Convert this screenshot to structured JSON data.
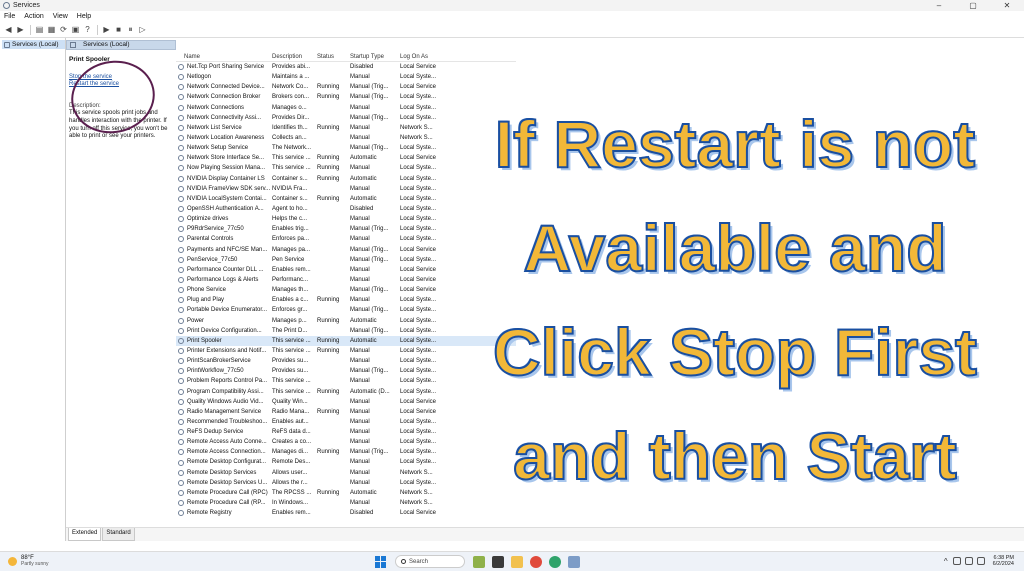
{
  "window": {
    "title": "Services",
    "controls": [
      "–",
      "▢",
      "✕"
    ]
  },
  "menu": [
    "File",
    "Action",
    "View",
    "Help"
  ],
  "tree": {
    "root": "Services (Local)"
  },
  "pane": {
    "header": "Services (Local)",
    "service_title": "Print Spooler",
    "stop_link": "Stop the service",
    "restart_link": "Restart the service",
    "description_label": "Description:",
    "description": "This service spools print jobs and handles interaction with the printer. If you turn off this service, you won't be able to print or see your printers."
  },
  "columns": [
    "Name",
    "Description",
    "Status",
    "Startup Type",
    "Log On As"
  ],
  "services": [
    [
      "Net.Tcp Port Sharing Service",
      "Provides abi...",
      "",
      "Disabled",
      "Local Service"
    ],
    [
      "Netlogon",
      "Maintains a ...",
      "",
      "Manual",
      "Local Syste..."
    ],
    [
      "Network Connected Device...",
      "Network Co...",
      "Running",
      "Manual (Trig...",
      "Local Service"
    ],
    [
      "Network Connection Broker",
      "Brokers con...",
      "Running",
      "Manual (Trig...",
      "Local Syste..."
    ],
    [
      "Network Connections",
      "Manages o...",
      "",
      "Manual",
      "Local Syste..."
    ],
    [
      "Network Connectivity Assi...",
      "Provides Dir...",
      "",
      "Manual (Trig...",
      "Local Syste..."
    ],
    [
      "Network List Service",
      "Identifies th...",
      "Running",
      "Manual",
      "Network S..."
    ],
    [
      "Network Location Awareness",
      "Collects an...",
      "",
      "Manual",
      "Network S..."
    ],
    [
      "Network Setup Service",
      "The Network...",
      "",
      "Manual (Trig...",
      "Local Syste..."
    ],
    [
      "Network Store Interface Se...",
      "This service ...",
      "Running",
      "Automatic",
      "Local Service"
    ],
    [
      "Now Playing Session Mana...",
      "This service ...",
      "Running",
      "Manual",
      "Local Syste..."
    ],
    [
      "NVIDIA Display Container LS",
      "Container s...",
      "Running",
      "Automatic",
      "Local Syste..."
    ],
    [
      "NVIDIA FrameView SDK serv...",
      "NVIDIA Fra...",
      "",
      "Manual",
      "Local Syste..."
    ],
    [
      "NVIDIA LocalSystem Contai...",
      "Container s...",
      "Running",
      "Automatic",
      "Local Syste..."
    ],
    [
      "OpenSSH Authentication A...",
      "Agent to ho...",
      "",
      "Disabled",
      "Local Syste..."
    ],
    [
      "Optimize drives",
      "Helps the c...",
      "",
      "Manual",
      "Local Syste..."
    ],
    [
      "P9RdrService_77c50",
      "Enables trig...",
      "",
      "Manual (Trig...",
      "Local Syste..."
    ],
    [
      "Parental Controls",
      "Enforces pa...",
      "",
      "Manual",
      "Local Syste..."
    ],
    [
      "Payments and NFC/SE Man...",
      "Manages pa...",
      "",
      "Manual (Trig...",
      "Local Service"
    ],
    [
      "PenService_77c50",
      "Pen Service",
      "",
      "Manual (Trig...",
      "Local Syste..."
    ],
    [
      "Performance Counter DLL ...",
      "Enables rem...",
      "",
      "Manual",
      "Local Service"
    ],
    [
      "Performance Logs & Alerts",
      "Performanc...",
      "",
      "Manual",
      "Local Service"
    ],
    [
      "Phone Service",
      "Manages th...",
      "",
      "Manual (Trig...",
      "Local Service"
    ],
    [
      "Plug and Play",
      "Enables a c...",
      "Running",
      "Manual",
      "Local Syste..."
    ],
    [
      "Portable Device Enumerator...",
      "Enforces gr...",
      "",
      "Manual (Trig...",
      "Local Syste..."
    ],
    [
      "Power",
      "Manages p...",
      "Running",
      "Automatic",
      "Local Syste..."
    ],
    [
      "Print Device Configuration...",
      "The Print D...",
      "",
      "Manual (Trig...",
      "Local Syste..."
    ],
    [
      "Print Spooler",
      "This service ...",
      "Running",
      "Automatic",
      "Local Syste..."
    ],
    [
      "Printer Extensions and Notif...",
      "This service ...",
      "Running",
      "Manual",
      "Local Syste..."
    ],
    [
      "PrintScanBrokerService",
      "Provides su...",
      "",
      "Manual",
      "Local Syste..."
    ],
    [
      "PrintWorkflow_77c50",
      "Provides su...",
      "",
      "Manual (Trig...",
      "Local Syste..."
    ],
    [
      "Problem Reports Control Pa...",
      "This service ...",
      "",
      "Manual",
      "Local Syste..."
    ],
    [
      "Program Compatibility Assi...",
      "This service ...",
      "Running",
      "Automatic (D...",
      "Local Syste..."
    ],
    [
      "Quality Windows Audio Vid...",
      "Quality Win...",
      "",
      "Manual",
      "Local Service"
    ],
    [
      "Radio Management Service",
      "Radio Mana...",
      "Running",
      "Manual",
      "Local Service"
    ],
    [
      "Recommended Troubleshoo...",
      "Enables aut...",
      "",
      "Manual",
      "Local Syste..."
    ],
    [
      "ReFS Dedup Service",
      "ReFS data d...",
      "",
      "Manual",
      "Local Syste..."
    ],
    [
      "Remote Access Auto Conne...",
      "Creates a co...",
      "",
      "Manual",
      "Local Syste..."
    ],
    [
      "Remote Access Connection...",
      "Manages di...",
      "Running",
      "Manual (Trig...",
      "Local Syste..."
    ],
    [
      "Remote Desktop Configurat...",
      "Remote Des...",
      "",
      "Manual",
      "Local Syste..."
    ],
    [
      "Remote Desktop Services",
      "Allows user...",
      "",
      "Manual",
      "Network S..."
    ],
    [
      "Remote Desktop Services U...",
      "Allows the r...",
      "",
      "Manual",
      "Local Syste..."
    ],
    [
      "Remote Procedure Call (RPC)",
      "The RPCSS ...",
      "Running",
      "Automatic",
      "Network S..."
    ],
    [
      "Remote Procedure Call (RP...",
      "In Windows...",
      "",
      "Manual",
      "Network S..."
    ],
    [
      "Remote Registry",
      "Enables rem...",
      "",
      "Disabled",
      "Local Service"
    ]
  ],
  "selected_service": "Print Spooler",
  "tabs": [
    "Extended",
    "Standard"
  ],
  "overlay": {
    "lines": [
      "If Restart is not",
      "Available and",
      "Click Stop First",
      "and then Start"
    ],
    "fill_color": "#f2b838",
    "outline_color": "#1a4fa0"
  },
  "taskbar": {
    "weather_temp": "88°F",
    "weather_desc": "Partly sunny",
    "search_placeholder": "Search",
    "time": "6:38 PM",
    "date": "6/2/2024"
  },
  "annotation_color": "#5a1f4e"
}
